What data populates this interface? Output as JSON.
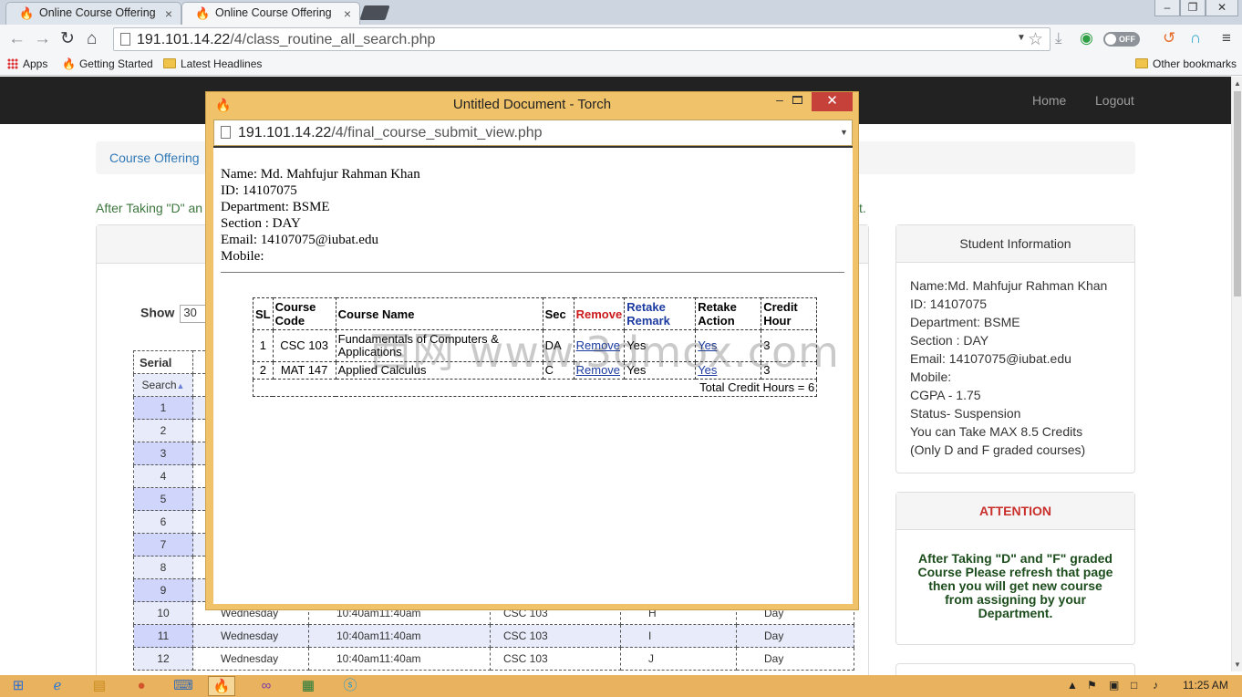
{
  "browser": {
    "tabs": [
      {
        "title": "Online Course Offering",
        "active": false
      },
      {
        "title": "Online Course Offering",
        "active": true
      }
    ],
    "url_host": "191.101.14.22",
    "url_path": "/4/class_routine_all_search.php",
    "toggle_label": "OFF",
    "bookmarks": {
      "apps": "Apps",
      "getting_started": "Getting Started",
      "latest_headlines": "Latest Headlines",
      "other": "Other bookmarks"
    }
  },
  "navbar": {
    "home": "Home",
    "logout": "Logout"
  },
  "breadcrumb": "Course Offering",
  "notice_start": "After Taking \"D\" an",
  "notice_end": "t.",
  "show": {
    "label": "Show",
    "value": "30"
  },
  "routine": {
    "headers": {
      "serial": "Serial",
      "search": "Search"
    },
    "serials": [
      "1",
      "2",
      "3",
      "4",
      "5",
      "6",
      "7",
      "8",
      "9"
    ],
    "rows": [
      {
        "serial": "10",
        "day": "Wednesday",
        "time": "10:40am11:40am",
        "course": "CSC 103",
        "section": "H",
        "shift": "Day"
      },
      {
        "serial": "11",
        "day": "Wednesday",
        "time": "10:40am11:40am",
        "course": "CSC 103",
        "section": "I",
        "shift": "Day"
      },
      {
        "serial": "12",
        "day": "Wednesday",
        "time": "10:40am11:40am",
        "course": "CSC 103",
        "section": "J",
        "shift": "Day"
      }
    ]
  },
  "student_panel": {
    "title": "Student Information",
    "lines": [
      "Name:Md. Mahfujur Rahman Khan",
      "ID: 14107075",
      "Department: BSME",
      "Section : DAY",
      "Email: 14107075@iubat.edu",
      "Mobile:",
      "CGPA - 1.75",
      "Status- Suspension",
      "You can Take MAX 8.5 Credits",
      "(Only D and F graded courses)"
    ]
  },
  "attention_panel": {
    "title": "ATTENTION",
    "body": "After Taking \"D\" and \"F\" graded Course Please refresh that page then you will get new course from assigning by your Department."
  },
  "popup": {
    "title": "Untitled Document - Torch",
    "url_host": "191.101.14.22",
    "url_path": "/4/final_course_submit_view.php",
    "student": {
      "name": "Name: Md. Mahfujur Rahman Khan",
      "id": "ID: 14107075",
      "department": "Department: BSME",
      "section": "Section : DAY",
      "email": "Email: 14107075@iubat.edu",
      "mobile": "Mobile:"
    },
    "table": {
      "headers": {
        "sl": "SL",
        "course_code": "Course Code",
        "course_name": "Course Name",
        "sec": "Sec",
        "remove": "Remove",
        "retake_remark": "Retake Remark",
        "retake_action": "Retake Action",
        "credit_hour": "Credit Hour"
      },
      "rows": [
        {
          "sl": "1",
          "code": "CSC 103",
          "name": "Fundamentals of Computers & Applications",
          "sec": "DA",
          "remove": "Remove",
          "remark": "Yes",
          "action": "Yes",
          "credit": "3"
        },
        {
          "sl": "2",
          "code": "MAT 147",
          "name": "Applied Calculus",
          "sec": "C",
          "remove": "Remove",
          "remark": "Yes",
          "action": "Yes",
          "credit": "3"
        }
      ],
      "total": "Total Credit Hours = 6"
    }
  },
  "watermark": "西网 www.3dmox.com",
  "taskbar": {
    "clock": "11:25 AM"
  },
  "colors": {
    "navbar": "#222222",
    "popup_frame": "#f0c36a",
    "close_button": "#c7413b",
    "remove_header": "#cc1a1a",
    "link_blue": "#1a3aa0",
    "attention": "#c9302c"
  }
}
